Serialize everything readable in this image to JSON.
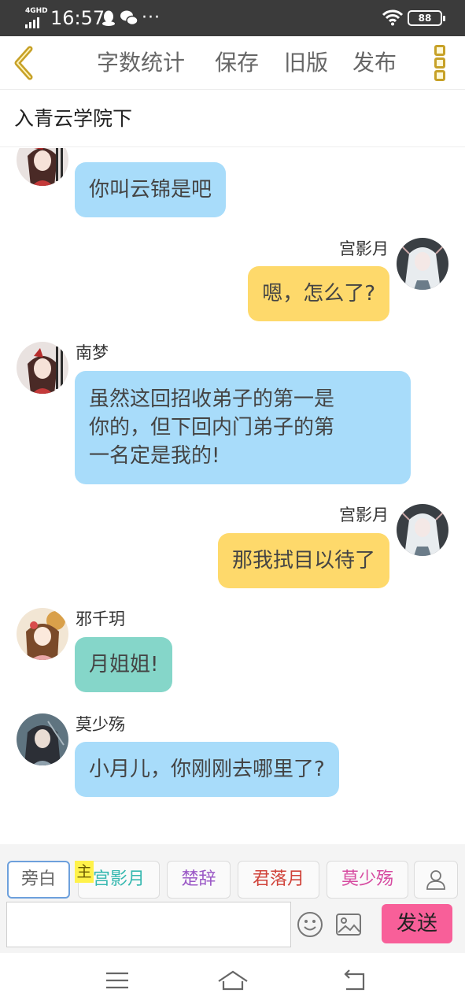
{
  "status_bar": {
    "network": "4GHD",
    "time": "16:57",
    "more": "···",
    "battery": "88"
  },
  "header": {
    "word_count": "字数统计",
    "save": "保存",
    "old_version": "旧版",
    "publish": "发布"
  },
  "chapter_title": "入青云学院下",
  "messages": [
    {
      "speaker": "南梦",
      "side": "left",
      "text": "你叫云锦是吧",
      "color": "#a8dcfa"
    },
    {
      "speaker": "宫影月",
      "side": "right",
      "text": "嗯，怎么了?",
      "color": "#fed96b"
    },
    {
      "speaker": "南梦",
      "side": "left",
      "text_lines": [
        "虽然这回招收弟子的第一是",
        "你的，但下回内门弟子的第",
        "一名定是我的!"
      ],
      "color": "#a8dcfa"
    },
    {
      "speaker": "宫影月",
      "side": "right",
      "text": "那我拭目以待了",
      "color": "#fed96b"
    },
    {
      "speaker": "邪千玥",
      "side": "left",
      "text": "月姐姐!",
      "color": "#85d6c9"
    },
    {
      "speaker": "莫少殇",
      "side": "left",
      "text": "小月儿，你刚刚去哪里了?",
      "color": "#a8dcfa"
    }
  ],
  "roles": {
    "narration": {
      "label": "旁白",
      "color": "#666666"
    },
    "owner_tag": "主",
    "list": [
      {
        "label": "宫影月",
        "color": "#36b8b0"
      },
      {
        "label": "楚辞",
        "color": "#9b59c6"
      },
      {
        "label": "君落月",
        "color": "#d0433a"
      },
      {
        "label": "莫少殇",
        "color": "#d64aa0"
      }
    ]
  },
  "composer": {
    "input_value": "",
    "send_label": "发送"
  }
}
